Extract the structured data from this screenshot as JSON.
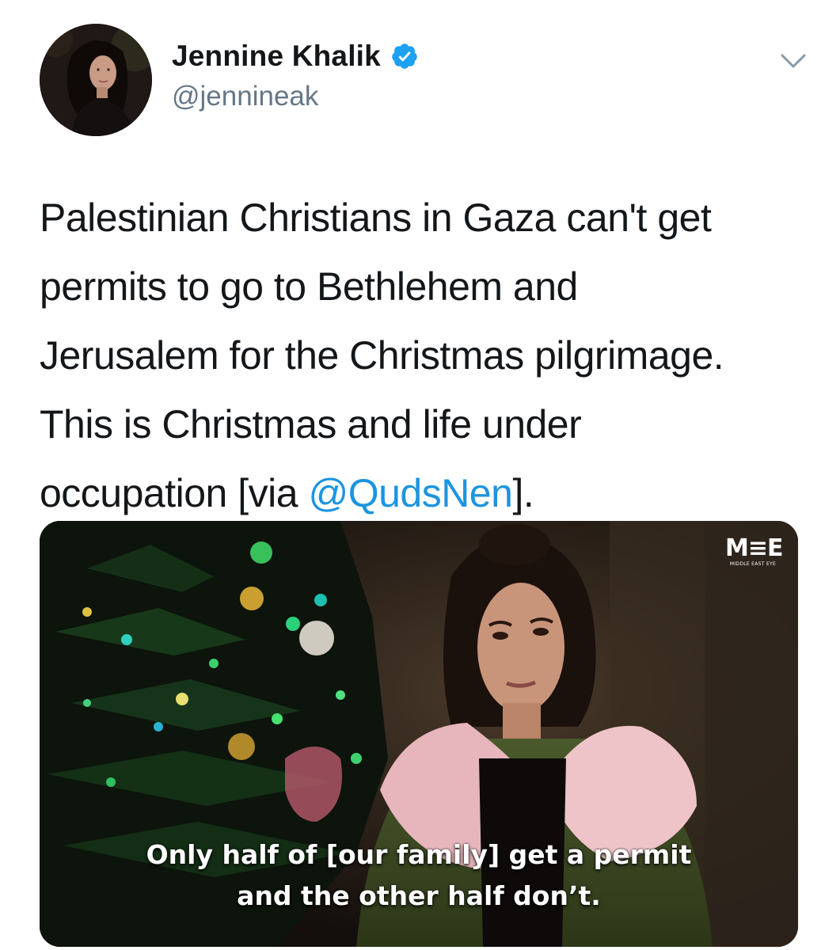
{
  "author": {
    "display_name": "Jennine Khalik",
    "handle": "@jennineak",
    "verified": true,
    "avatar_icon": "avatar-photo"
  },
  "menu": {
    "icon": "chevron-down-icon"
  },
  "tweet": {
    "text_lines": [
      "Palestinian Christians in Gaza can't get",
      "permits to go to Bethlehem and",
      "Jerusalem for the Christmas pilgrimage.",
      "This is Christmas and life under"
    ],
    "last_line_prefix": "occupation [via ",
    "mention": "@QudsNen",
    "last_line_suffix": "]."
  },
  "media": {
    "logo_mark": "M≡E",
    "logo_sub": "MIDDLE EAST EYE",
    "caption_lines": [
      "Only half of [our family] get a permit",
      "and the other half don’t."
    ]
  },
  "colors": {
    "text": "#14171a",
    "secondary": "#657786",
    "link": "#1b95e0",
    "verified": "#1da1f2"
  }
}
